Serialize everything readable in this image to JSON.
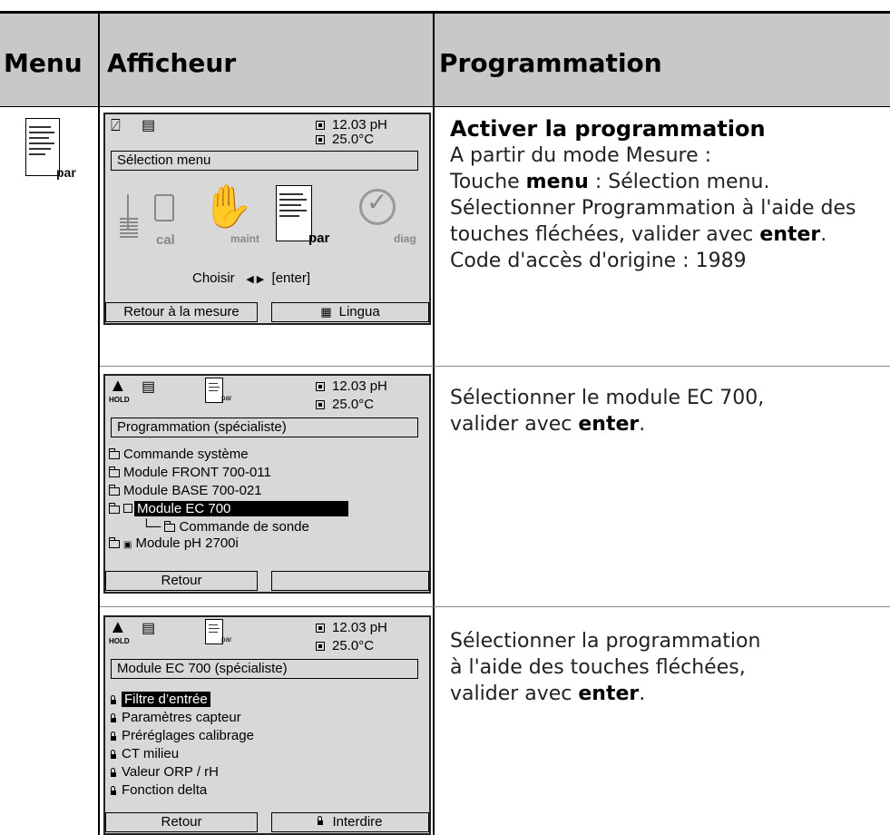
{
  "header": {
    "col_menu": "Menu",
    "col_display": "Afficheur",
    "col_program": "Programmation"
  },
  "rows": [
    {
      "screen": {
        "pv1": "12.03 pH",
        "pv2": "25.0°C",
        "title": "Sélection menu",
        "icons": {
          "cal": "cal",
          "maint": "maint",
          "par": "par",
          "diag": "diag"
        },
        "choose": "Choisir",
        "arrows": "◀ ▶",
        "enter": "[enter]",
        "softkey_left": "Retour à la mesure",
        "softkey_right": "Lingua"
      },
      "text": {
        "title": "Activer la programmation",
        "line1": "A partir du mode Mesure :",
        "line2_pre": "Touche ",
        "line2_bold": "menu",
        "line2_post": " : Sélection menu.",
        "line3": "Sélectionner Programmation à l'aide des",
        "line4_pre": "touches fléchées, valider avec ",
        "line4_bold": "enter",
        "line4_post": ".",
        "line5": "Code d'accès d'origine : 1989"
      },
      "menu_icon_label": "par"
    },
    {
      "screen": {
        "pv1": "12.03 pH",
        "pv2": "25.0°C",
        "hold": "HOLD",
        "par": "par",
        "title": "Programmation (spécialiste)",
        "items": [
          "Commande système",
          "Module FRONT 700-011",
          "Module BASE 700-021",
          "Module EC 700",
          "Commande de sonde",
          "Module pH 2700i"
        ],
        "softkey_left": "Retour",
        "softkey_right": ""
      },
      "text": {
        "line1": "Sélectionner le module EC 700,",
        "line2_pre": "valider avec ",
        "line2_bold": "enter",
        "line2_post": "."
      }
    },
    {
      "screen": {
        "pv1": "12.03 pH",
        "pv2": "25.0°C",
        "hold": "HOLD",
        "par": "par",
        "title": "Module EC 700 (spécialiste)",
        "items": [
          "Filtre d’entrée",
          "Paramètres capteur",
          "Préréglages calibrage",
          "CT milieu",
          "Valeur ORP / rH",
          "Fonction delta"
        ],
        "softkey_left": "Retour",
        "softkey_right": "Interdire"
      },
      "text": {
        "line1": "Sélectionner la programmation",
        "line2": "à l'aide des touches fléchées,",
        "line3_pre": "valider avec ",
        "line3_bold": "enter",
        "line3_post": "."
      }
    }
  ]
}
